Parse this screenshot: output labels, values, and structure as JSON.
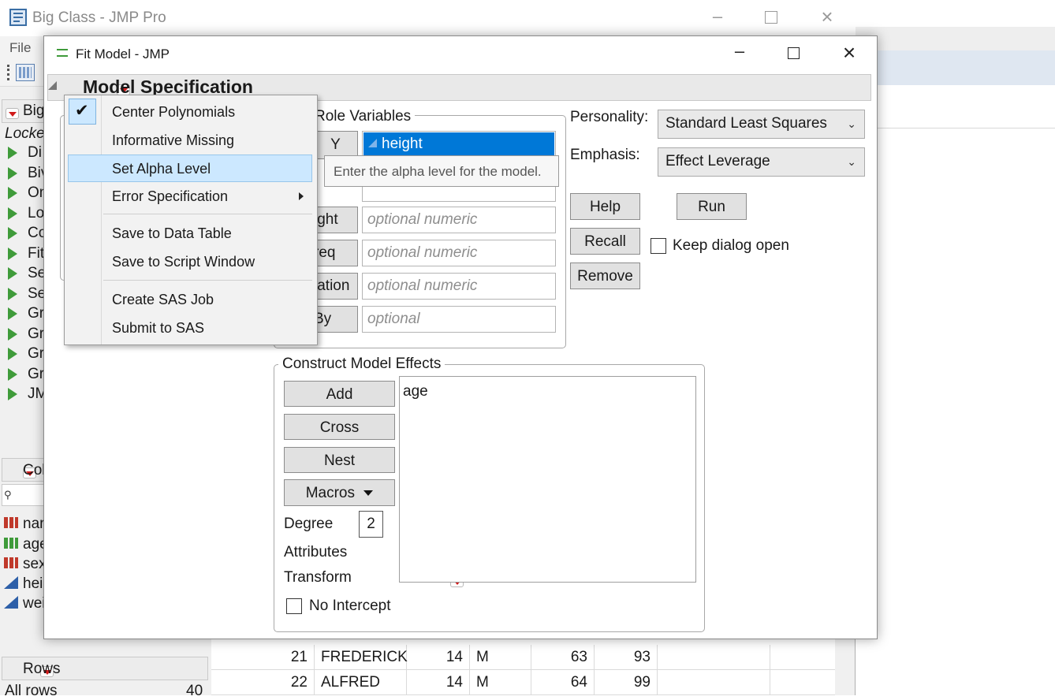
{
  "background_window": {
    "title": "Big Class - JMP Pro",
    "menu_file": "File",
    "panel_table_name": "Big",
    "locked_label": "Locke",
    "scripts": [
      "Di",
      "Biv",
      "On",
      "Lo",
      "Co",
      "Fit",
      "Se",
      "Se",
      "Gr",
      "Gr",
      "Gr",
      "Gr",
      "JM"
    ],
    "columns_label": "Col",
    "columns": [
      "nar",
      "age",
      "sex",
      "hei",
      "wei"
    ],
    "rows_label": "Rows",
    "all_rows_label": "All rows",
    "all_rows_count": "40",
    "data_rows": [
      {
        "row": "21",
        "name": "FREDERICK",
        "age": "14",
        "sex": "M",
        "height": "63",
        "weight": "93"
      },
      {
        "row": "22",
        "name": "ALFRED",
        "age": "14",
        "sex": "M",
        "height": "64",
        "weight": "99"
      }
    ]
  },
  "dialog": {
    "title": "Fit Model - JMP",
    "section_title": "Model Specification",
    "role_variables_label": "Role Variables",
    "roles": {
      "y_label": "Y",
      "y_value": "height",
      "weight_label": "ight",
      "weight_placeholder": "optional numeric",
      "freq_label": "req",
      "freq_placeholder": "optional numeric",
      "validation_label": "lation",
      "validation_placeholder": "optional numeric",
      "by_label": "By",
      "by_placeholder": "optional"
    },
    "personality_label": "Personality:",
    "personality_value": "Standard Least Squares",
    "emphasis_label": "Emphasis:",
    "emphasis_value": "Effect Leverage",
    "buttons": {
      "help": "Help",
      "run": "Run",
      "recall": "Recall",
      "remove": "Remove"
    },
    "keep_dialog_open_label": "Keep dialog open",
    "construct_label": "Construct Model Effects",
    "construct_buttons": {
      "add": "Add",
      "cross": "Cross",
      "nest": "Nest",
      "macros": "Macros"
    },
    "degree_label": "Degree",
    "degree_value": "2",
    "attributes_label": "Attributes",
    "transform_label": "Transform",
    "no_intercept_label": "No Intercept",
    "effects": [
      "age"
    ]
  },
  "menu": {
    "items": [
      {
        "label": "Center Polynomials",
        "checked": true
      },
      {
        "label": "Informative Missing"
      },
      {
        "label": "Set Alpha Level",
        "highlighted": true
      },
      {
        "label": "Error Specification",
        "submenu": true
      },
      {
        "label": "Save to Data Table"
      },
      {
        "label": "Save to Script Window"
      },
      {
        "label": "Create SAS Job"
      },
      {
        "label": "Submit to SAS"
      }
    ]
  },
  "tooltip": "Enter the alpha level for the model.",
  "colors": {
    "accent": "#0078d7",
    "highlight": "#cce8ff",
    "red_triangle": "#d01b1b",
    "green_triangle": "#3f9b3a"
  }
}
